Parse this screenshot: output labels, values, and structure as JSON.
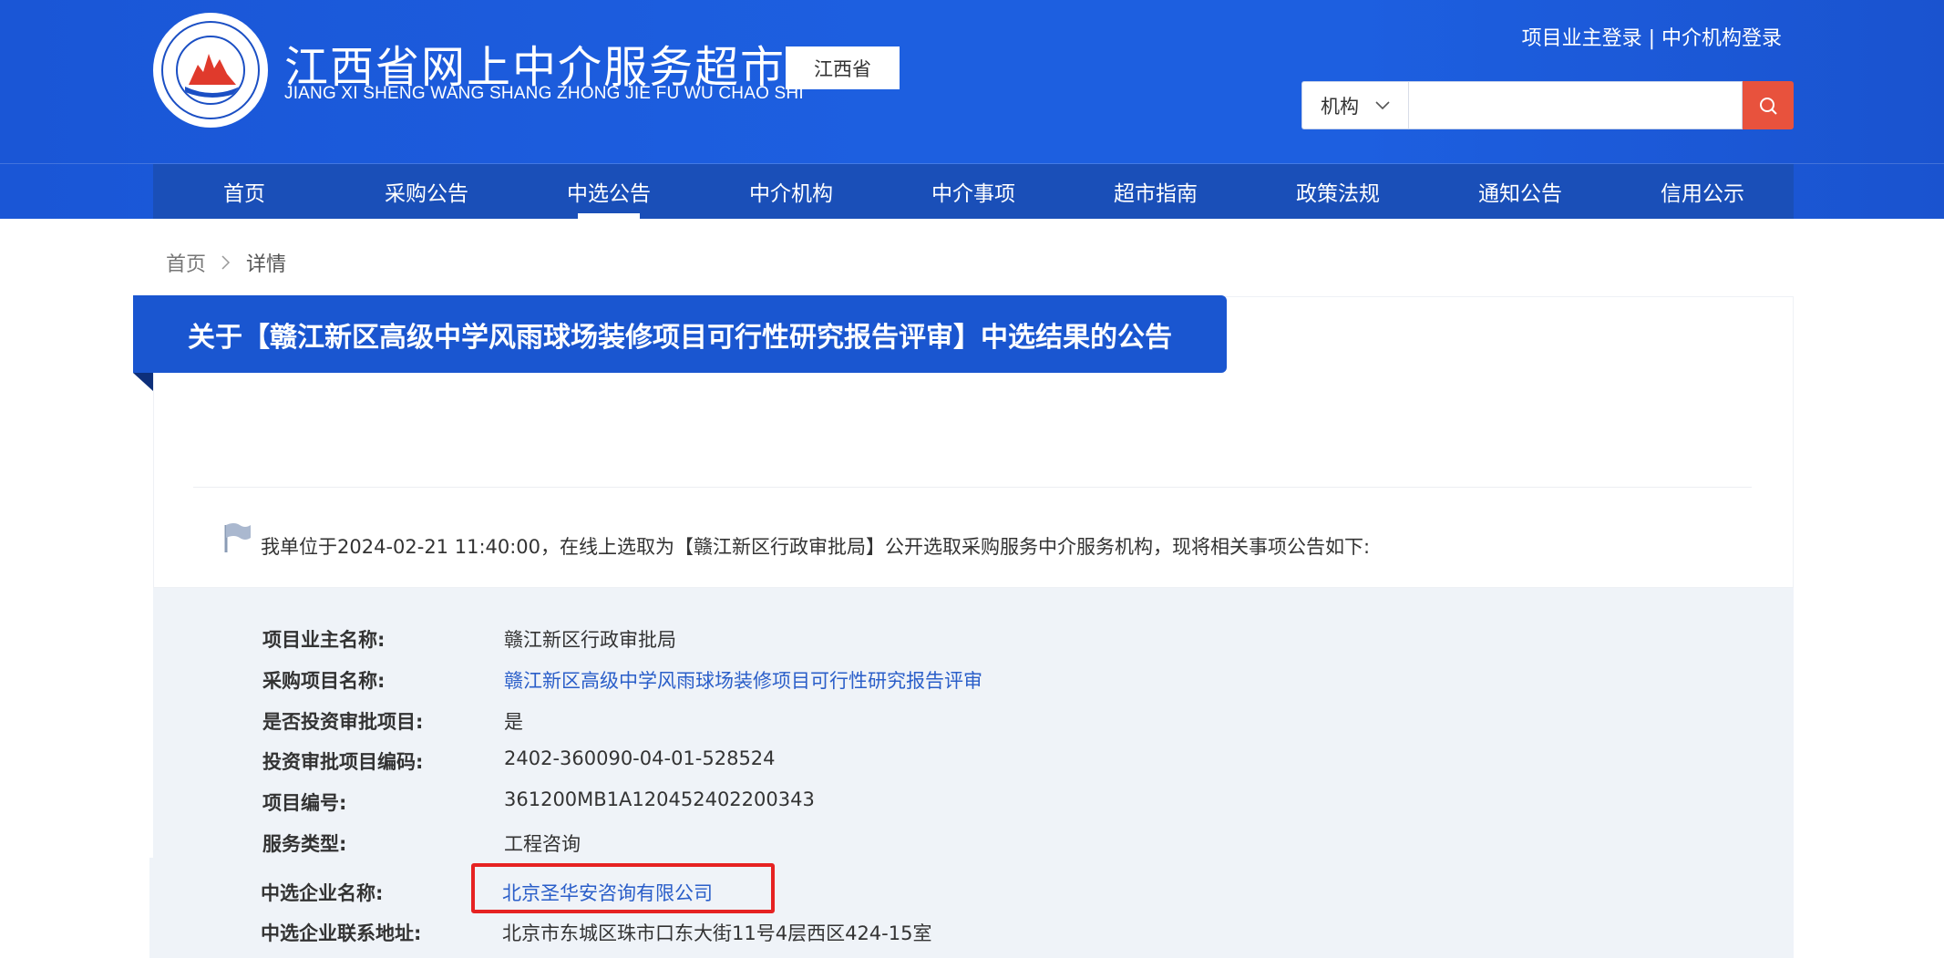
{
  "header": {
    "site_title": "江西省网上中介服务超市",
    "site_subtitle": "JIANG XI SHENG WANG SHANG ZHONG JIE FU WU CHAO SHI",
    "province": "江西省",
    "owner_login": "项目业主登录",
    "separator": " | ",
    "agency_login": "中介机构登录",
    "search": {
      "select_value": "机构",
      "placeholder": ""
    }
  },
  "nav": {
    "items": [
      {
        "label": "首页"
      },
      {
        "label": "采购公告"
      },
      {
        "label": "中选公告"
      },
      {
        "label": "中介机构"
      },
      {
        "label": "中介事项"
      },
      {
        "label": "超市指南"
      },
      {
        "label": "政策法规"
      },
      {
        "label": "通知公告"
      },
      {
        "label": "信用公示"
      }
    ],
    "active_index": 2
  },
  "breadcrumb": {
    "home": "首页",
    "current": "详情"
  },
  "notice": {
    "title": "关于【赣江新区高级中学风雨球场装修项目可行性研究报告评审】中选结果的公告",
    "intro": "我单位于2024-02-21 11:40:00，在线上选取为【赣江新区行政审批局】公开选取采购服务中介服务机构，现将相关事项公告如下:"
  },
  "details": {
    "rows": [
      {
        "label": "项目业主名称:",
        "value": "赣江新区行政审批局"
      },
      {
        "label": "采购项目名称:",
        "value": "赣江新区高级中学风雨球场装修项目可行性研究报告评审"
      },
      {
        "label": "是否投资审批项目:",
        "value": "是"
      },
      {
        "label": "投资审批项目编码:",
        "value": "2402-360090-04-01-528524"
      },
      {
        "label": "项目编号:",
        "value": "361200MB1A120452402200343"
      },
      {
        "label": "服务类型:",
        "value": "工程咨询"
      },
      {
        "label": "中选企业名称:",
        "value": "北京圣华安咨询有限公司"
      },
      {
        "label": "中选企业联系地址:",
        "value": "北京市东城区珠市口东大街11号4层西区424-15室"
      }
    ]
  },
  "colors": {
    "header_blue": "#1d5fe0",
    "nav_blue": "#1a4fb8",
    "search_red": "#e8523d",
    "link_blue": "#2a5ec9",
    "highlight_red": "#e62222"
  }
}
